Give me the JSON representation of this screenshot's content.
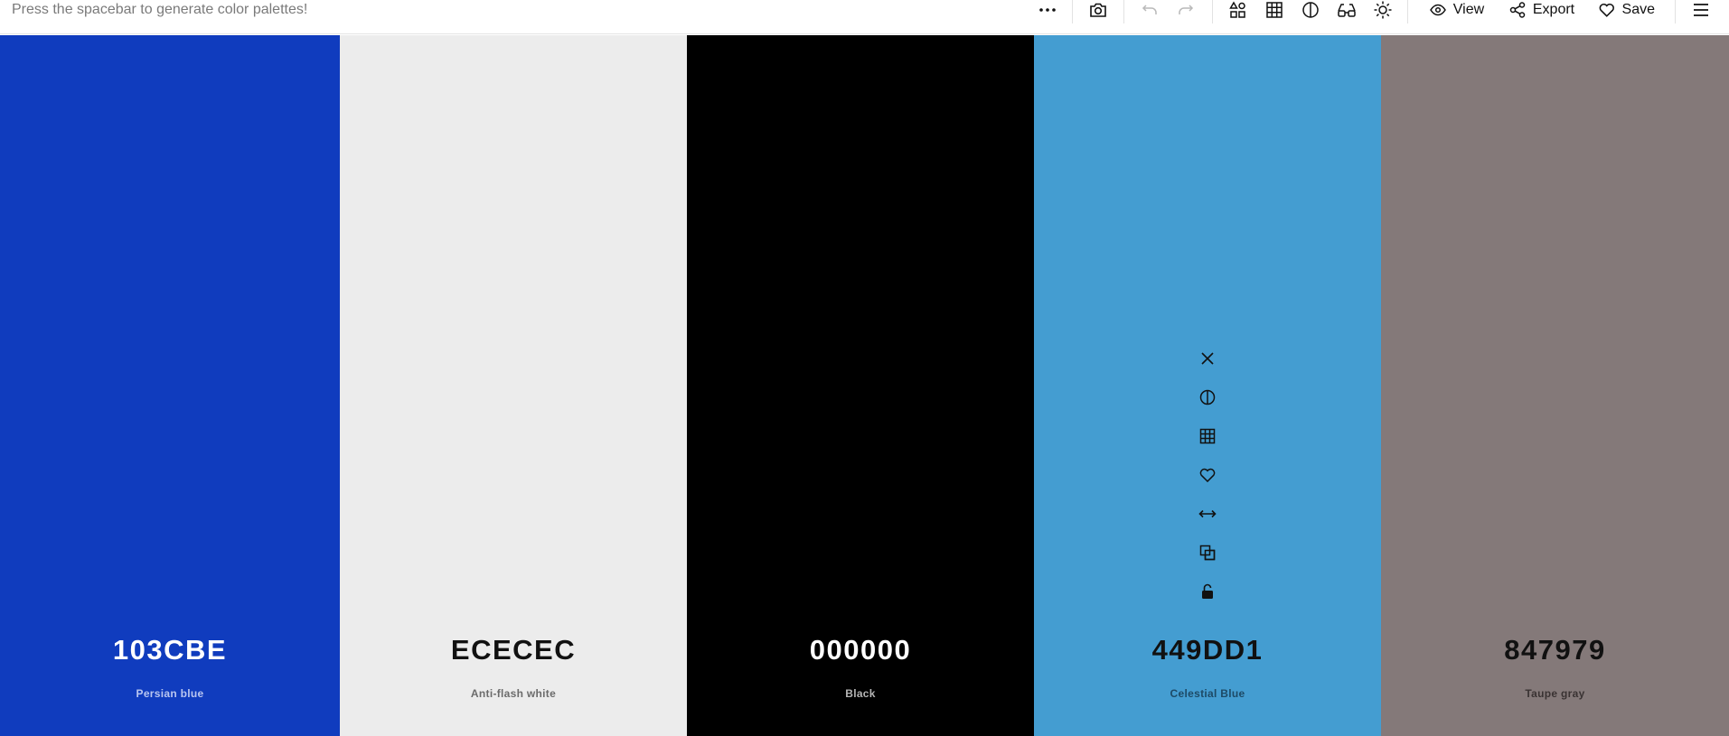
{
  "header": {
    "hint": "Press the spacebar to generate color palettes!",
    "view_label": "View",
    "export_label": "Export",
    "save_label": "Save"
  },
  "palette": [
    {
      "hex": "103CBE",
      "name": "Persian blue",
      "color": "#103CBE",
      "text_color": "#ffffff",
      "name_color": "#b9c6f0"
    },
    {
      "hex": "ECECEC",
      "name": "Anti-flash white",
      "color": "#ECECEC",
      "text_color": "#111111",
      "name_color": "#6b6b6b"
    },
    {
      "hex": "000000",
      "name": "Black",
      "color": "#000000",
      "text_color": "#ffffff",
      "name_color": "#b5b5b5"
    },
    {
      "hex": "449DD1",
      "name": "Celestial Blue",
      "color": "#449DD1",
      "text_color": "#111111",
      "name_color": "#1d4a66"
    },
    {
      "hex": "847979",
      "name": "Taupe gray",
      "color": "#847979",
      "text_color": "#111111",
      "name_color": "#3a3333"
    }
  ],
  "icons": {
    "column_tools": [
      "close-icon",
      "contrast-icon",
      "shades-grid-icon",
      "heart-icon",
      "drag-arrows-icon",
      "copy-icon",
      "unlock-icon"
    ]
  }
}
